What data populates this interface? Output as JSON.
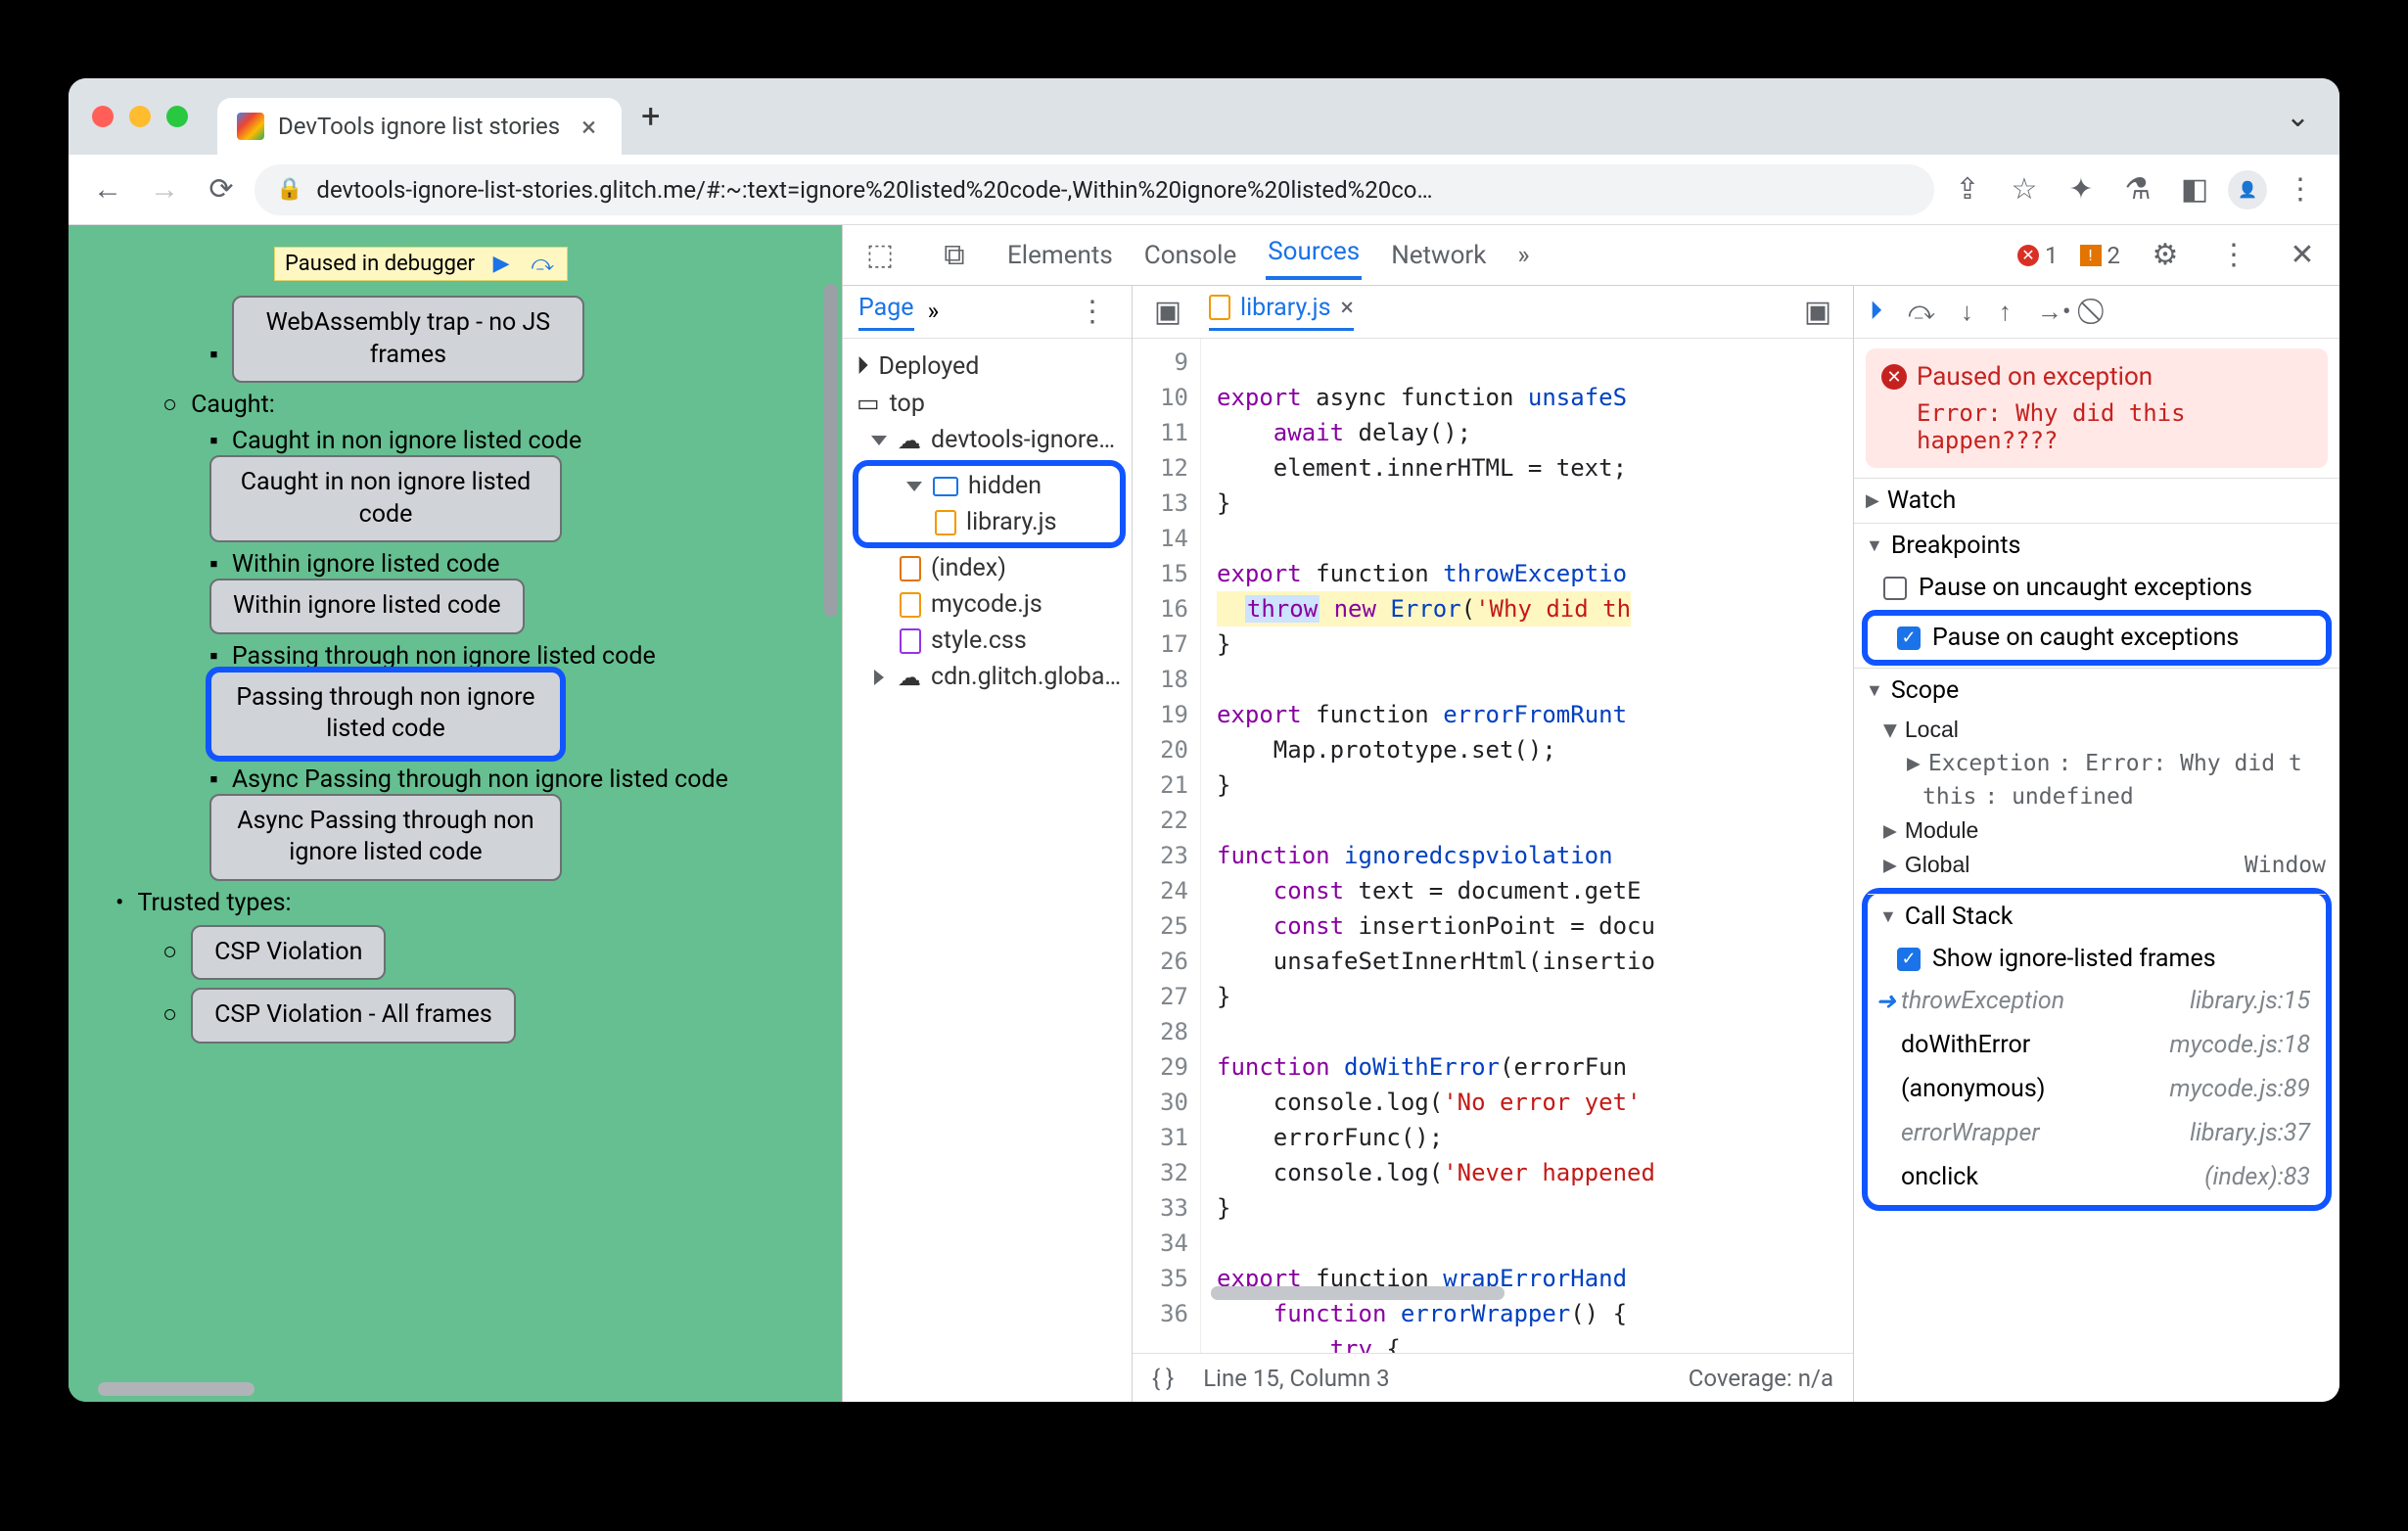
{
  "browser": {
    "tab_title": "DevTools ignore list stories",
    "url": "devtools-ignore-list-stories.glitch.me/#:~:text=ignore%20listed%20code-,Within%20ignore%20listed%20co…"
  },
  "paused_banner": "Paused in debugger",
  "page": {
    "wasm_btn": "WebAssembly trap - no JS frames",
    "caught_h": "Caught:",
    "li1": "Caught in non ignore listed code",
    "btn1": "Caught in non ignore listed code",
    "li2": "Within ignore listed code",
    "btn2": "Within ignore listed code",
    "li3": "Passing through non ignore listed code",
    "btn3": "Passing through non ignore listed code",
    "li4": "Async Passing through non ignore listed code",
    "btn4": "Async Passing through non ignore listed code",
    "trusted_h": "Trusted types:",
    "csp1": "CSP Violation",
    "csp2": "CSP Violation - All frames"
  },
  "dt": {
    "tabs": {
      "elements": "Elements",
      "console": "Console",
      "sources": "Sources",
      "network": "Network"
    },
    "errors": "1",
    "warnings": "2",
    "nav": {
      "page": "Page",
      "deployed": "Deployed",
      "top": "top",
      "site": "devtools-ignore…",
      "hidden": "hidden",
      "library": "library.js",
      "index": "(index)",
      "mycode": "mycode.js",
      "style": "style.css",
      "cdn": "cdn.glitch.globa…"
    },
    "editor": {
      "filename": "library.js",
      "lines": [
        "9",
        "10",
        "11",
        "12",
        "13",
        "14",
        "15",
        "16",
        "17",
        "18",
        "19",
        "20",
        "21",
        "22",
        "23",
        "24",
        "25",
        "26",
        "27",
        "28",
        "29",
        "30",
        "31",
        "32",
        "33",
        "34",
        "35",
        "36"
      ],
      "l9a": "export",
      "l9b": " async function ",
      "l9c": "unsafeS",
      "l10a": "await",
      "l10b": " delay();",
      "l11": "    element.innerHTML = text;",
      "l12": "}",
      "l14a": "export",
      "l14b": " function ",
      "l14c": "throwExceptio",
      "l15a": "throw",
      "l15b": " new ",
      "l15c": "Error",
      "l15d": "(",
      "l15e": "'Why did th",
      "l16": "}",
      "l18a": "export",
      "l18b": " function ",
      "l18c": "errorFromRunt",
      "l19": "    Map.prototype.set();",
      "l20": "}",
      "l22a": "function ",
      "l22b": "ignoredcspviolation",
      "l23a": "const",
      "l23b": " text = document.getE",
      "l24a": "const",
      "l24b": " insertionPoint = docu",
      "l25": "    unsafeSetInnerHtml(insertio",
      "l26": "}",
      "l28a": "function ",
      "l28b": "doWithError",
      "l28c": "(errorFun",
      "l29a": "    console.log(",
      "l29b": "'No error yet'",
      "l30": "    errorFunc();",
      "l31a": "    console.log(",
      "l31b": "'Never happened",
      "l32": "}",
      "l34a": "export",
      "l34b": " function ",
      "l34c": "wrapErrorHand",
      "l35a": "function ",
      "l35b": "errorWrapper",
      "l35c": "() {",
      "l36a": "try",
      "l36b": " {",
      "status_pos": "Line 15, Column 3",
      "status_cov": "Coverage: n/a"
    },
    "dbg": {
      "exc_title": "Paused on exception",
      "exc_msg": "Error: Why did this happen????",
      "watch": "Watch",
      "breakpoints": "Breakpoints",
      "bp_uncaught": "Pause on uncaught exceptions",
      "bp_caught": "Pause on caught exceptions",
      "scope": "Scope",
      "local": "Local",
      "exc_k": "Exception",
      "exc_v": ": Error: Why did t",
      "this_k": "this",
      "this_v": ": undefined",
      "module": "Module",
      "global": "Global",
      "window": "Window",
      "callstack": "Call Stack",
      "show_ign": "Show ignore-listed frames",
      "frames": [
        {
          "fn": "throwException",
          "loc": "library.js:15",
          "ign": true,
          "cur": true
        },
        {
          "fn": "doWithError",
          "loc": "mycode.js:18",
          "ign": false,
          "cur": false
        },
        {
          "fn": "(anonymous)",
          "loc": "mycode.js:89",
          "ign": false,
          "cur": false
        },
        {
          "fn": "errorWrapper",
          "loc": "library.js:37",
          "ign": true,
          "cur": false
        },
        {
          "fn": "onclick",
          "loc": "(index):83",
          "ign": false,
          "cur": false
        }
      ]
    }
  }
}
